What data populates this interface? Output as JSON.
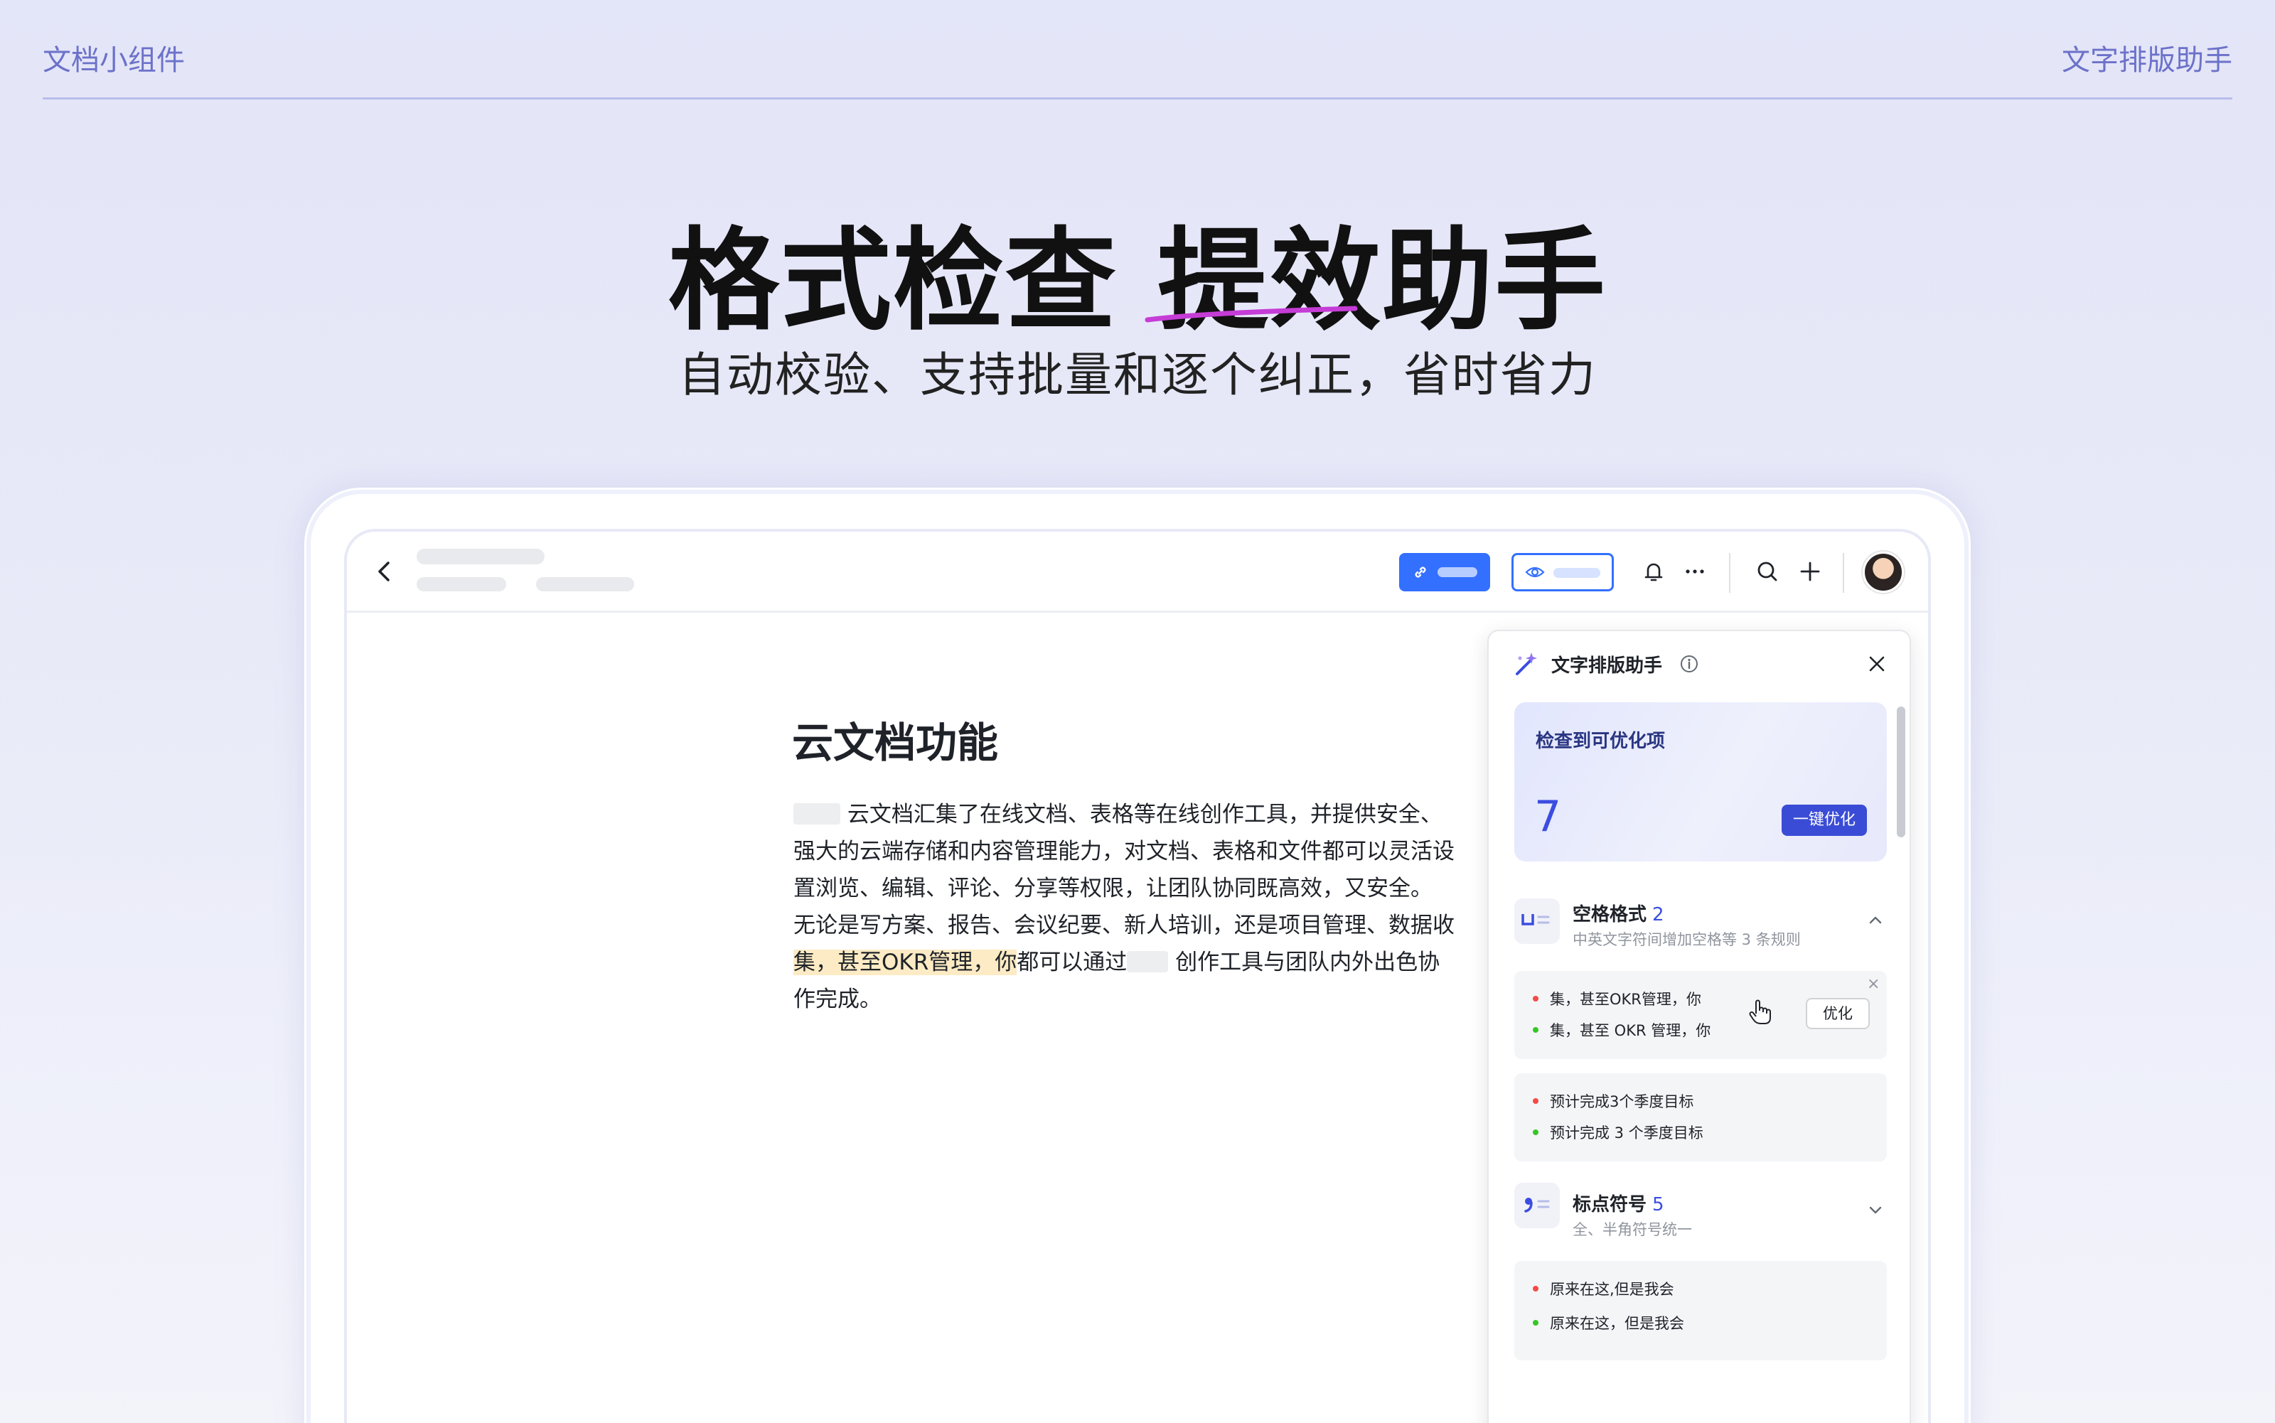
{
  "header": {
    "left_label": "文档小组件",
    "right_label": "文字排版助手"
  },
  "hero": {
    "title_part1": "格式检查",
    "title_highlight": "提效",
    "title_part2": "助手",
    "subtitle": "自动校验、支持批量和逐个纠正，省时省力",
    "underline_color": "#c53cd6"
  },
  "toolbar": {
    "icons": [
      "back-icon",
      "link-icon",
      "eye-icon",
      "bell-icon",
      "more-icon",
      "search-icon",
      "plus-icon",
      "avatar"
    ],
    "share_color": "#3370ff"
  },
  "document": {
    "title": "云文档功能",
    "paragraph1": "云文档汇集了在线文档、表格等在线创作工具，并提供安全、强大的云端存储和内容管理能力，对文档、表格和文件都可以灵活设置浏览、编辑、评论、分享等权限，让团队协同既高效，又安全。",
    "paragraph2_start": "无论是写方案、报告、会议纪要、新人培训，还是项目管理、数据收",
    "paragraph2_highlight": "集，甚至OKR管理，你",
    "paragraph2_mid": "都可以通过",
    "paragraph2_end": "创作工具与团队内外出色协作完成。"
  },
  "panel": {
    "title": "文字排版助手",
    "summary_label": "检查到可优化项",
    "summary_count": "7",
    "optimize_all": "一键优化",
    "sections": [
      {
        "title": "空格格式",
        "count": "2",
        "desc": "中英文字符间增加空格等 3 条规则",
        "items": [
          {
            "before": "集，甚至OKR管理，你",
            "after": "集，甚至 OKR 管理，你",
            "action": "优化",
            "close": "×"
          },
          {
            "before": "预计完成3个季度目标",
            "after": "预计完成 3 个季度目标"
          }
        ]
      },
      {
        "title": "标点符号",
        "count": "5",
        "desc": "全、半角符号统一",
        "items": [
          {
            "before": "原来在这,但是我会",
            "after": "原来在这，但是我会"
          }
        ]
      }
    ]
  }
}
